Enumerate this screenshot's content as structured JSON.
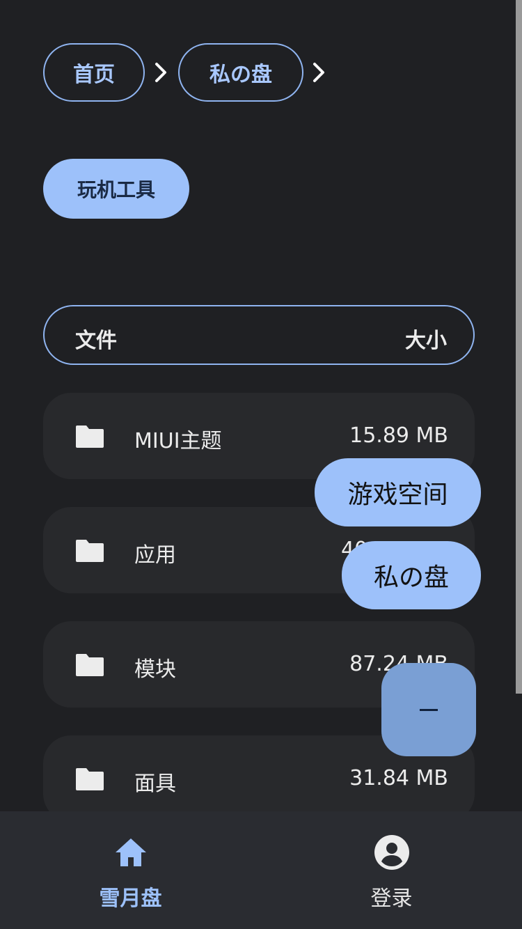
{
  "breadcrumb": {
    "items": [
      {
        "label": "首页"
      },
      {
        "label": "私の盘"
      }
    ]
  },
  "tag": {
    "label": "玩机工具"
  },
  "table": {
    "header_name": "文件",
    "header_size": "大小",
    "rows": [
      {
        "name": "MIUI主题",
        "size": "15.89 MB"
      },
      {
        "name": "应用",
        "size": "40"
      },
      {
        "name": "模块",
        "size": "87.24 MB"
      },
      {
        "name": "面具",
        "size": "31.84 MB"
      }
    ]
  },
  "fab_menu": {
    "items": [
      {
        "label": "游戏空间"
      },
      {
        "label": "私の盘"
      }
    ],
    "main_icon": "minus-icon"
  },
  "bottom_nav": {
    "items": [
      {
        "label": "雪月盘",
        "icon": "home-icon",
        "active": true
      },
      {
        "label": "登录",
        "icon": "account-circle-icon",
        "active": false
      }
    ]
  },
  "colors": {
    "background": "#1f2023",
    "accent": "#9dc1fa",
    "row_background": "#28292c",
    "nav_background": "#2a2c31"
  }
}
